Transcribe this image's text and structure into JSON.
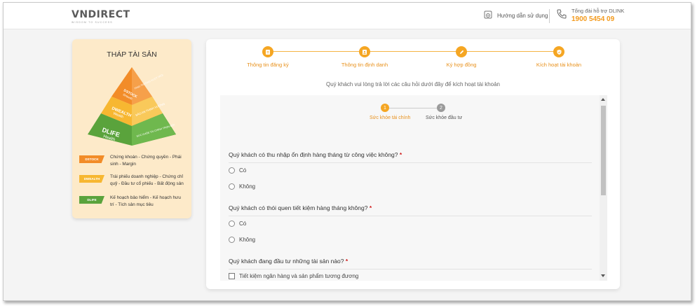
{
  "header": {
    "logo": "VNDIRECT",
    "logo_tagline": "WISDOM TO SUCCESS",
    "guide_label": "Hướng dẫn sử dụng",
    "support_label": "Tổng đài hỗ trợ DLINK",
    "support_number": "1900 5454 09"
  },
  "pyramid": {
    "title": "THÁP TÀI SẢN",
    "tiers": [
      {
        "name": "DSTOCK",
        "sub": "Growth",
        "right": "TĂNG TRƯỞNG VƯỢT TRỘI",
        "color": "#f28c28"
      },
      {
        "name": "DWEALTH",
        "sub": "Wealth",
        "right": "BẢO AN THỊNH VƯỢNG",
        "color": "#f7b731"
      },
      {
        "name": "DLIFE",
        "sub": "Health",
        "right": "SỨC KHỎE TÀI CHÍNH TRỌN ĐỜI",
        "color": "#5aa33c"
      }
    ],
    "legend": [
      {
        "tag": "DSTOCK",
        "color": "#f28c28",
        "text": "Chứng khoán - Chứng quyền - Phái sinh - Margin"
      },
      {
        "tag": "DWEALTH",
        "color": "#f7b731",
        "text": "Trái phiếu doanh nghiệp - Chứng chỉ quỹ - Đầu tư cổ phiếu - Bất động sản"
      },
      {
        "tag": "DLIFE",
        "color": "#5aa33c",
        "text": "Kế hoạch bảo hiểm - Kế hoạch hưu trí - Tích sản mục tiêu"
      }
    ]
  },
  "steps": [
    {
      "label": "Thông tin đăng ký",
      "icon": "form-icon"
    },
    {
      "label": "Thông tin định danh",
      "icon": "id-card-icon"
    },
    {
      "label": "Ký hợp đồng",
      "icon": "pen-icon"
    },
    {
      "label": "Kích hoạt tài khoản",
      "icon": "shield-check-icon"
    }
  ],
  "intro": "Quý khách vui lòng trả lời các câu hỏi dưới đây để kích hoạt tài khoản",
  "substeps": [
    {
      "num": "1",
      "label": "Sức khỏe tài chính",
      "active": true
    },
    {
      "num": "2",
      "label": "Sức khỏe đầu tư",
      "active": false
    }
  ],
  "questions": [
    {
      "text": "Quý khách có thu nhập ổn định hàng tháng từ công việc không?",
      "required": "*",
      "options": [
        "Có",
        "Không"
      ]
    },
    {
      "text": "Quý khách có thói quen tiết kiệm hàng tháng không?",
      "required": "*",
      "options": [
        "Có",
        "Không"
      ]
    },
    {
      "text": "Quý khách đang đầu tư những tài sản nào?",
      "required": "*",
      "options": [
        "Tiết kiệm ngân hàng và sản phẩm tương đương"
      ]
    }
  ],
  "colors": {
    "accent": "#f5a623",
    "required": "#d01c1c"
  }
}
